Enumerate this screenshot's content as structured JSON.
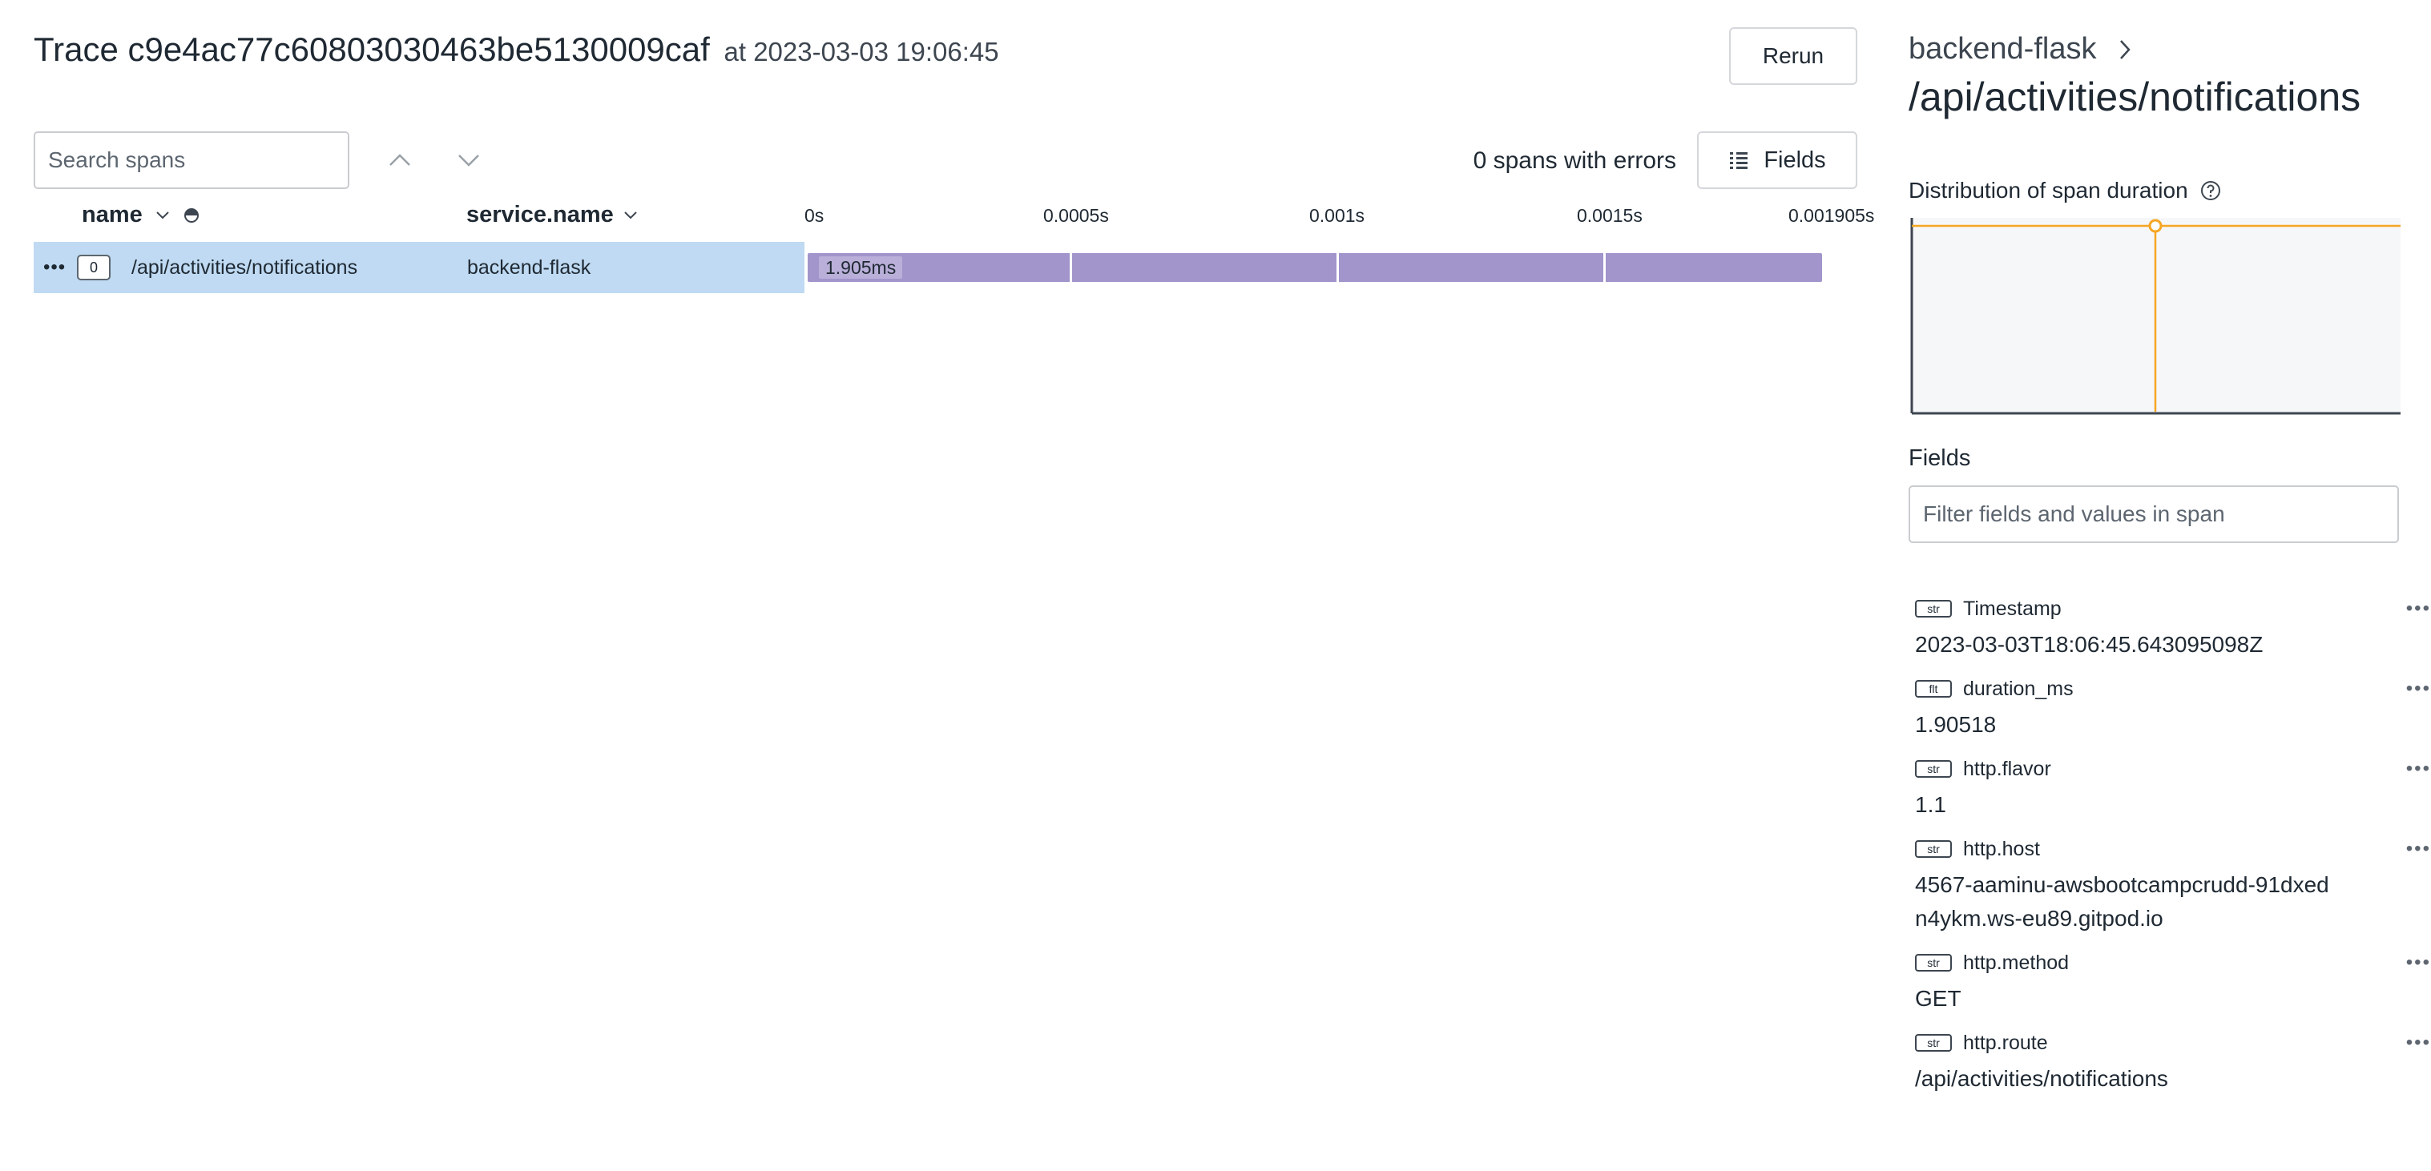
{
  "header": {
    "trace_label": "Trace c9e4ac77c60803030463be5130009caf",
    "timestamp": "at 2023-03-03 19:06:45",
    "rerun_label": "Rerun"
  },
  "toolbar": {
    "search_placeholder": "Search spans",
    "errors_text": "0 spans with errors",
    "fields_label": "Fields"
  },
  "columns": {
    "name": "name",
    "service": "service.name",
    "ticks": [
      "0s",
      "0.0005s",
      "0.001s",
      "0.0015s",
      "0.001905s"
    ]
  },
  "span": {
    "depth": "0",
    "name": "/api/activities/notifications",
    "service": "backend-flask",
    "duration_label": "1.905ms",
    "duration_fraction": 1.0
  },
  "panel": {
    "service": "backend-flask",
    "span_name": "/api/activities/notifications",
    "dist_title": "Distribution of span duration",
    "fields_title": "Fields",
    "filter_placeholder": "Filter fields and values in span",
    "fields": [
      {
        "type": "str",
        "key": "Timestamp",
        "value": "2023-03-03T18:06:45.643095098Z"
      },
      {
        "type": "flt",
        "key": "duration_ms",
        "value": "1.90518"
      },
      {
        "type": "str",
        "key": "http.flavor",
        "value": "1.1"
      },
      {
        "type": "str",
        "key": "http.host",
        "value": "4567-aaminu-awsbootcampcrudd-91dxedn4ykm.ws-eu89.gitpod.io"
      },
      {
        "type": "str",
        "key": "http.method",
        "value": "GET"
      },
      {
        "type": "str",
        "key": "http.route",
        "value": "/api/activities/notifications"
      }
    ]
  },
  "colors": {
    "row_selected": "#bfdaf2",
    "span_bar": "#a195cb",
    "distribution_line": "#f5a623"
  }
}
